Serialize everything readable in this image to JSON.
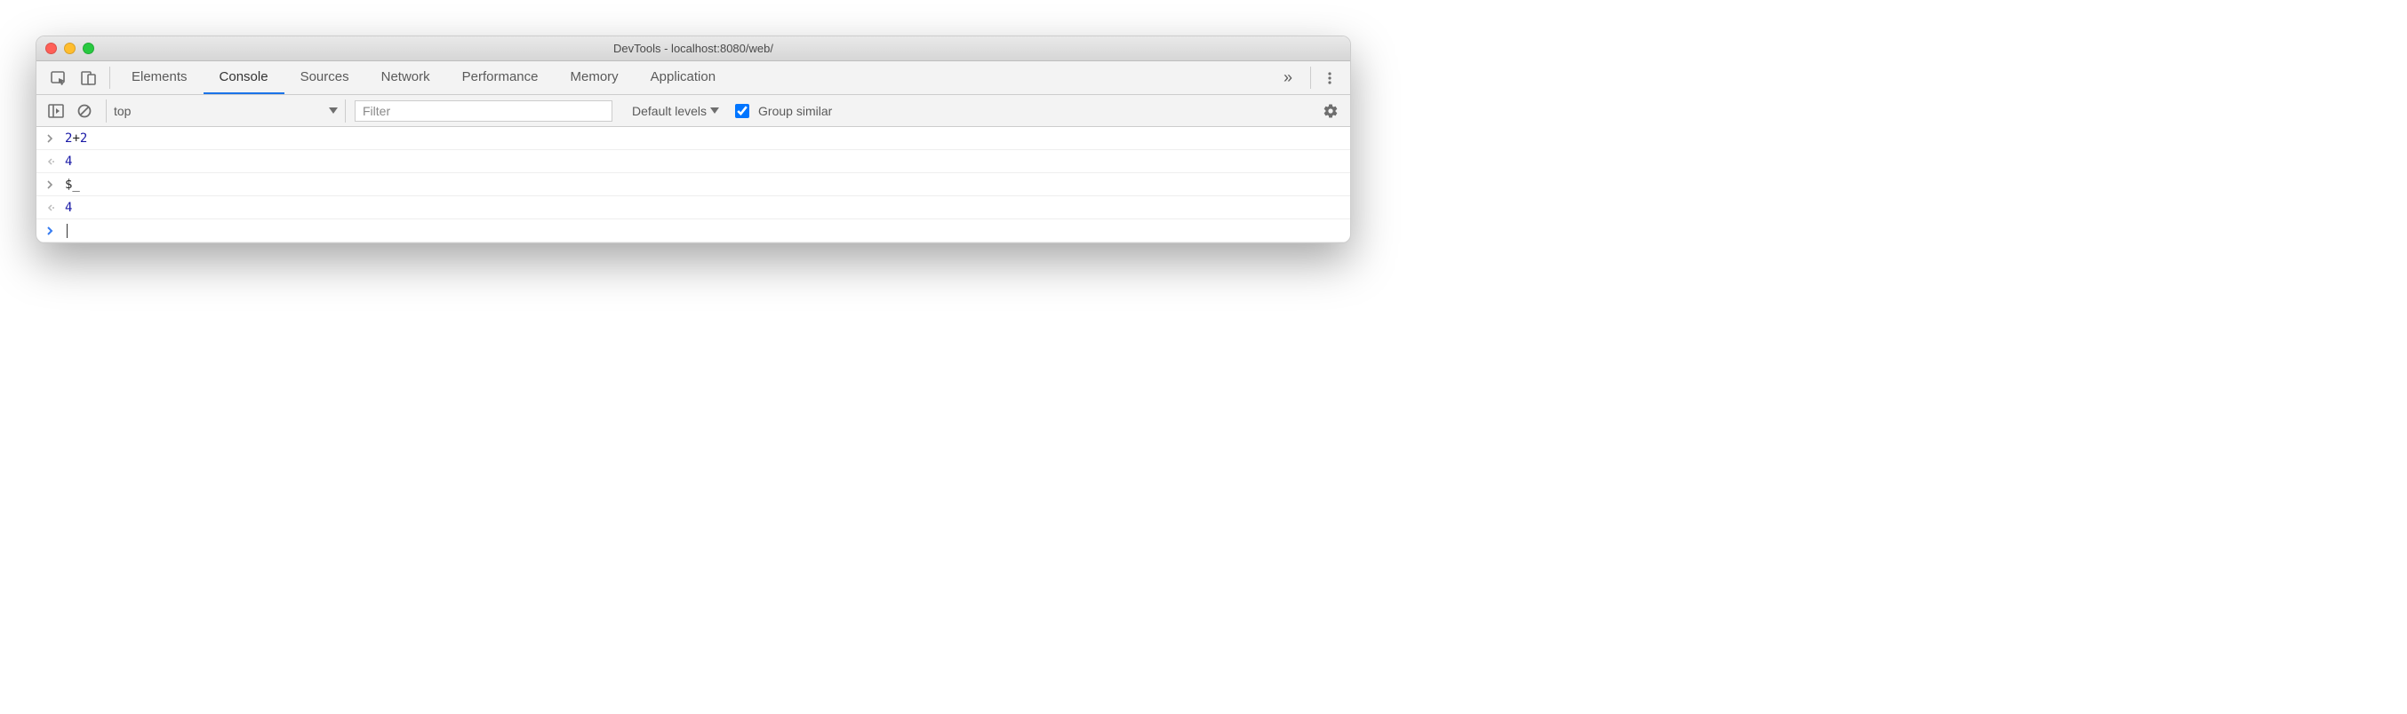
{
  "window": {
    "title": "DevTools - localhost:8080/web/"
  },
  "tabs": {
    "items": [
      {
        "label": "Elements",
        "active": false
      },
      {
        "label": "Console",
        "active": true
      },
      {
        "label": "Sources",
        "active": false
      },
      {
        "label": "Network",
        "active": false
      },
      {
        "label": "Performance",
        "active": false
      },
      {
        "label": "Memory",
        "active": false
      },
      {
        "label": "Application",
        "active": false
      }
    ]
  },
  "toolbar": {
    "context": "top",
    "filter_placeholder": "Filter",
    "filter_value": "",
    "levels_label": "Default levels",
    "group_similar_checked": true,
    "group_similar_label": "Group similar"
  },
  "console": {
    "rows": [
      {
        "kind": "input",
        "marker": ">",
        "segments": [
          {
            "t": "2",
            "c": "blue"
          },
          {
            "t": "+",
            "c": "black"
          },
          {
            "t": "2",
            "c": "blue"
          }
        ]
      },
      {
        "kind": "result",
        "marker": "<·",
        "segments": [
          {
            "t": "4",
            "c": "blue"
          }
        ]
      },
      {
        "kind": "input",
        "marker": ">",
        "segments": [
          {
            "t": "$_",
            "c": "black"
          }
        ]
      },
      {
        "kind": "result",
        "marker": "<·",
        "segments": [
          {
            "t": "4",
            "c": "blue"
          }
        ]
      },
      {
        "kind": "prompt",
        "marker": ">",
        "segments": []
      }
    ]
  }
}
